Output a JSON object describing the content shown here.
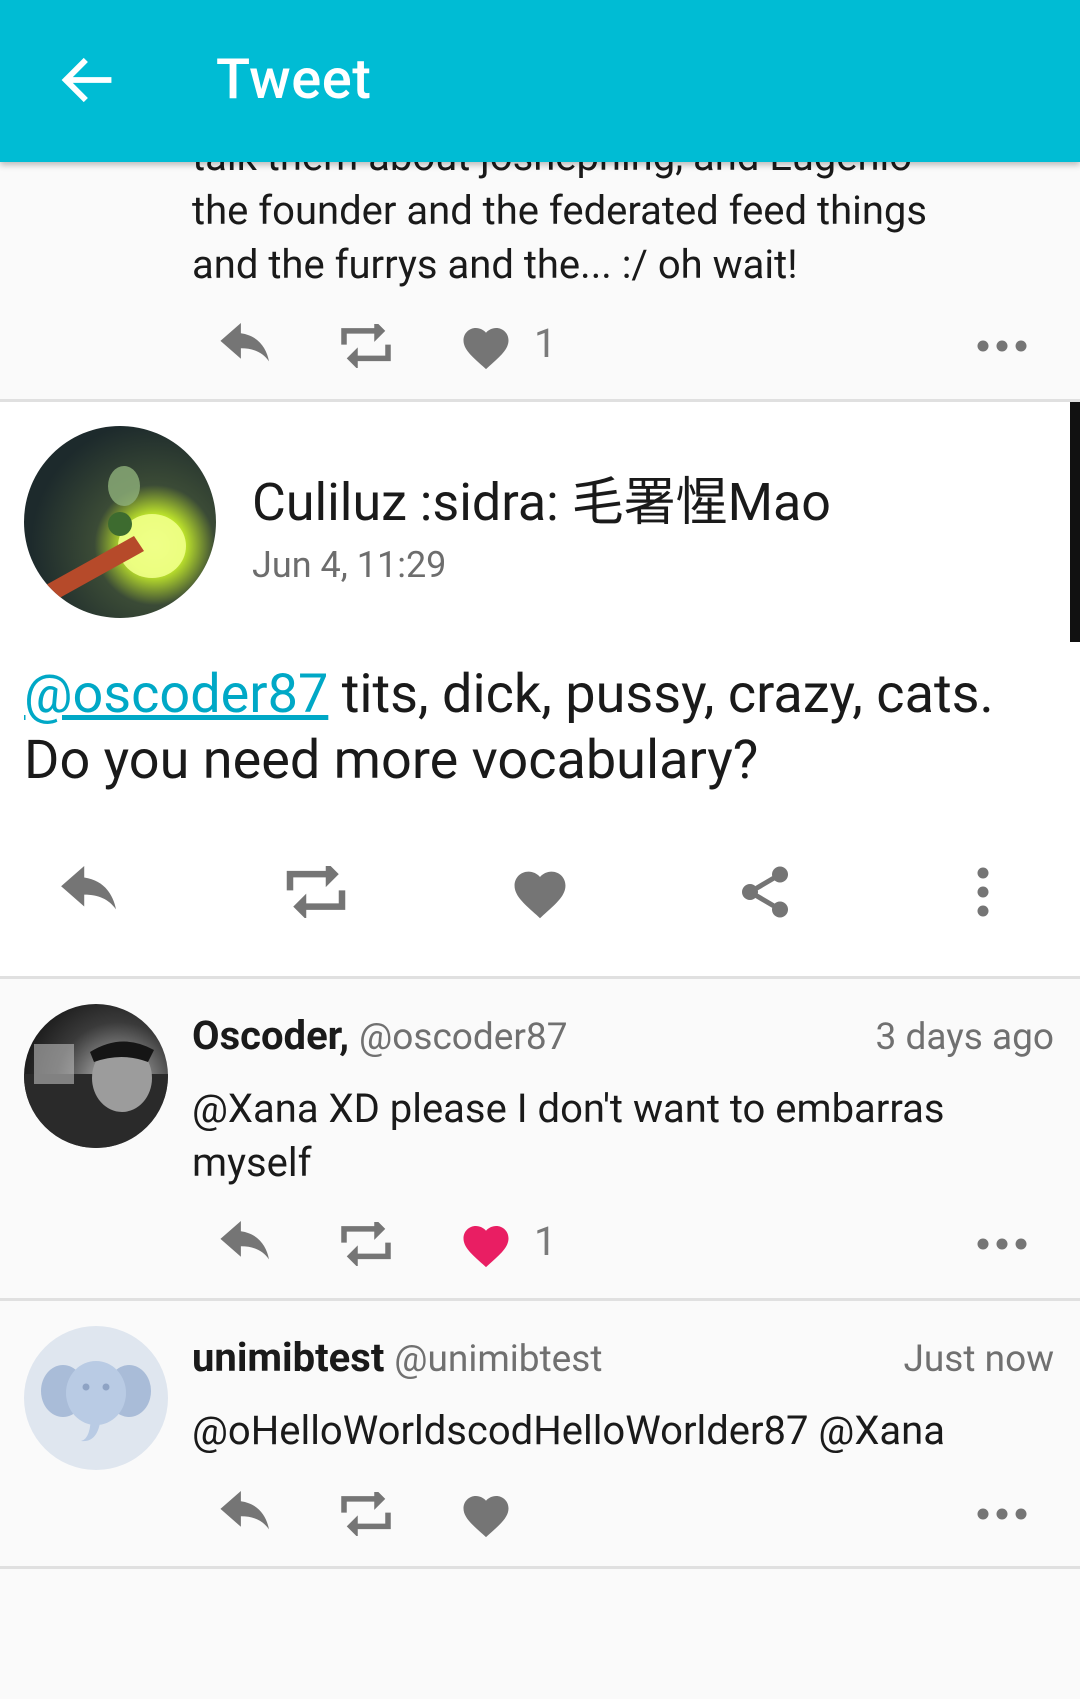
{
  "app_bar": {
    "title": "Tweet"
  },
  "previous_post": {
    "text_cut": "talk them about joshephing, and Eugenio",
    "text_line_2": "the founder and the federated feed things",
    "text_line_3": "and the furrys and the... :/ oh wait!",
    "like_count": "1"
  },
  "focused_post": {
    "display_name": "Culiluz :sidra: 毛署惺Mao",
    "timestamp": "Jun 4, 11:29",
    "mention": "@oscoder87",
    "body_rest": " tits, dick, pussy, crazy, cats. Do you need more vocabulary?"
  },
  "replies": [
    {
      "display_name": "Oscoder,",
      "handle": "@oscoder87",
      "time": "3 days ago",
      "text": "@Xana XD please I don't want to embarras myself",
      "like_count": "1",
      "liked": true
    },
    {
      "display_name": "unimibtest",
      "handle": "@unimibtest",
      "time": "Just now",
      "text": "@oHelloWorldscodHelloWorlder87 @Xana",
      "like_count": "",
      "liked": false
    }
  ],
  "colors": {
    "app_bar": "#00bcd4",
    "mention": "#00a8c6",
    "liked": "#e91e63",
    "icon_gray": "#757575"
  },
  "icons": [
    "back-arrow-icon",
    "reply-icon",
    "retweet-icon",
    "heart-icon",
    "share-icon",
    "more-vertical-icon",
    "more-horizontal-icon"
  ]
}
